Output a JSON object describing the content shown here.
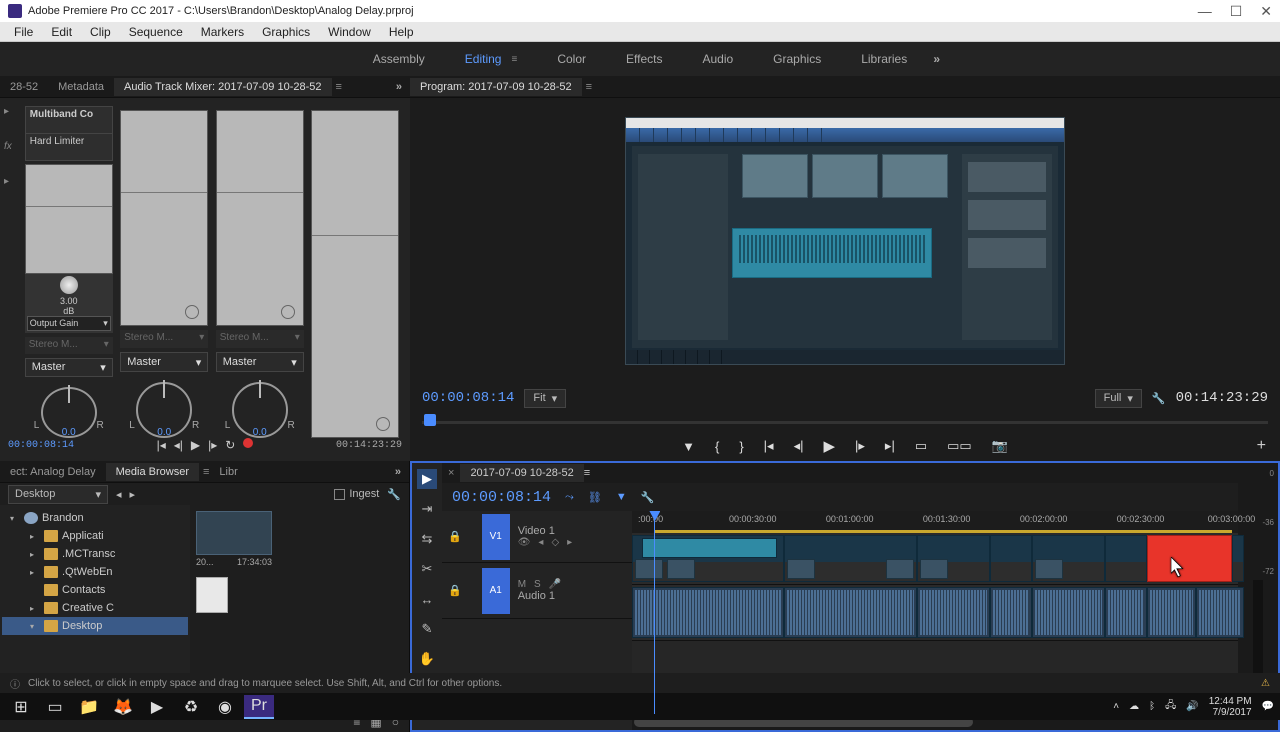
{
  "titlebar": {
    "app": "Adobe Premiere Pro CC 2017",
    "path": "C:\\Users\\Brandon\\Desktop\\Analog Delay.prproj"
  },
  "menu": [
    "File",
    "Edit",
    "Clip",
    "Sequence",
    "Markers",
    "Graphics",
    "Window",
    "Help"
  ],
  "workspaces": {
    "items": [
      "Assembly",
      "Editing",
      "Color",
      "Effects",
      "Audio",
      "Graphics",
      "Libraries"
    ],
    "active": "Editing"
  },
  "mixer": {
    "tabs": {
      "left": "28-52",
      "meta": "Metadata",
      "active": "Audio Track Mixer: 2017-07-09 10-28-52"
    },
    "fx": {
      "a": "Multiband Co",
      "b": "Hard Limiter"
    },
    "gain": {
      "value": "3.00",
      "unit": "dB",
      "label": "Output Gain"
    },
    "stereo": "Stereo M...",
    "master": "Master",
    "pan": {
      "l": "L",
      "r": "R",
      "val": "0.0"
    },
    "tc_in": "00:00:08:14",
    "tc_out": "00:14:23:29"
  },
  "program": {
    "tab": "Program: 2017-07-09 10-28-52",
    "tc": "00:00:08:14",
    "fit": "Fit",
    "full": "Full",
    "duration": "00:14:23:29"
  },
  "project": {
    "tabs": {
      "a": "ect: Analog Delay",
      "b": "Media Browser",
      "c": "Libr"
    },
    "combo": "Desktop",
    "ingest": "Ingest",
    "tree": {
      "user": "Brandon",
      "items": [
        "Applicati",
        ".MCTransc",
        ".QtWebEn",
        "Contacts",
        "Creative C",
        "Desktop"
      ]
    },
    "thumb": {
      "name": "20...",
      "dur": "17:34:03"
    }
  },
  "timeline": {
    "tab": "2017-07-09 10-28-52",
    "tc": "00:00:08:14",
    "ruler": [
      ":00:00",
      "00:00:30:00",
      "00:01:00:00",
      "00:01:30:00",
      "00:02:00:00",
      "00:02:30:00",
      "00:03:00:00"
    ],
    "v1": "V1",
    "a1": "A1",
    "v_label": "Video 1",
    "a_label": "Audio 1",
    "msr": {
      "m": "M",
      "s": "S"
    },
    "meters": [
      "0",
      "-36",
      "-72"
    ]
  },
  "status": {
    "hint": "Click to select, or click in empty space and drag to marquee select. Use Shift, Alt, and Ctrl for other options."
  },
  "taskbar": {
    "time": "12:44 PM",
    "date": "7/9/2017"
  }
}
